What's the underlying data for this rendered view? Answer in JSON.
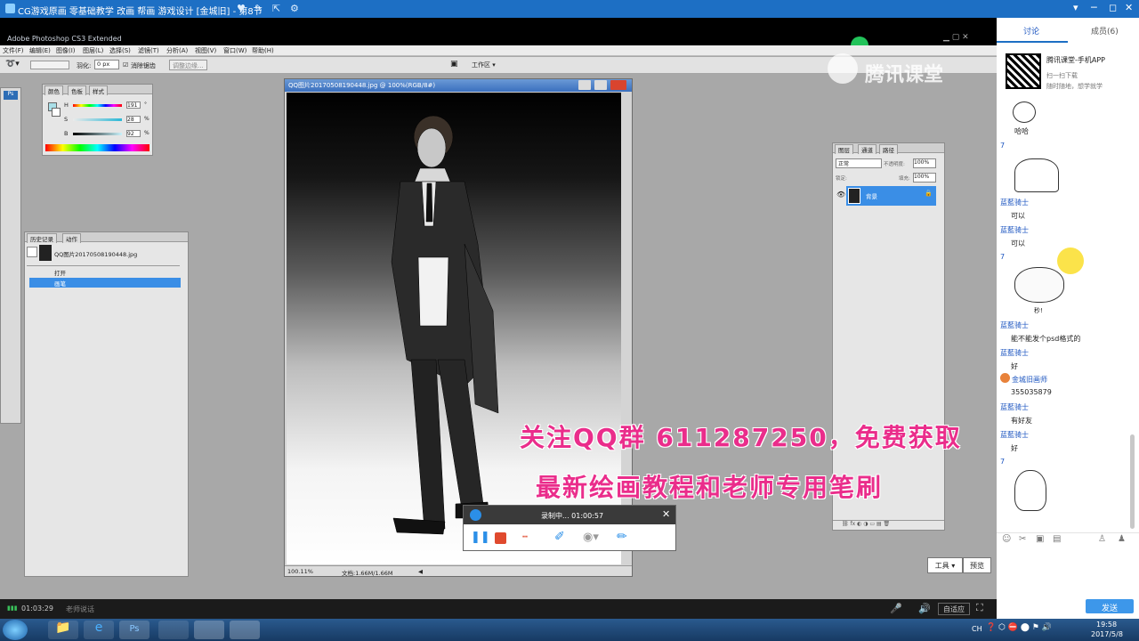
{
  "window": {
    "title": "CG游戏原画 零基础教学 改画 帮画 游戏设计 [金城旧] - 第8节",
    "controls": [
      "▾",
      "─",
      "◻",
      "✕"
    ]
  },
  "photoshop": {
    "app_title": "Adobe Photoshop CS3 Extended",
    "menus": [
      "文件(F)",
      "编辑(E)",
      "图像(I)",
      "图层(L)",
      "选择(S)",
      "滤镜(T)",
      "分析(A)",
      "视图(V)",
      "窗口(W)",
      "帮助(H)"
    ],
    "options": {
      "feather_label": "羽化:",
      "feather_value": "0 px",
      "antialias_label": "消除锯齿",
      "refine_label": "调整边缘...",
      "workspace_label": "工作区 ▾"
    },
    "color_panel": {
      "tabs": [
        "颜色",
        "色板",
        "样式"
      ],
      "sliders": [
        {
          "label": "H",
          "value": "191",
          "unit": "°"
        },
        {
          "label": "S",
          "value": "28",
          "unit": "%"
        },
        {
          "label": "B",
          "value": "92",
          "unit": "%"
        }
      ]
    },
    "history_panel": {
      "tabs": [
        "历史记录",
        "动作"
      ],
      "snapshot": "QQ图片20170508190448.jpg",
      "items": [
        "打开",
        "画笔"
      ]
    },
    "layers_panel": {
      "tabs": [
        "图层",
        "通道",
        "路径"
      ],
      "blend_mode": "正常",
      "opacity_label": "不透明度:",
      "opacity_value": "100%",
      "lock_label": "锁定:",
      "fill_label": "填充:",
      "fill_value": "100%",
      "layer_name": "背景"
    },
    "document": {
      "title": "QQ图片20170508190448.jpg @ 100%(RGB/8#)",
      "zoom": "100.11%",
      "doc_size": "文档:1.66M/1.66M"
    }
  },
  "overlay": {
    "promo_line1": "关注QQ群 611287250，免费获取",
    "promo_line2": "最新绘画教程和老师专用笔刷",
    "watermark": "腾讯课堂"
  },
  "recorder": {
    "status": "录制中... 01:00:57"
  },
  "player": {
    "elapsed": "01:03:29",
    "teacher_label": "老师说话",
    "fit_label": "自适应"
  },
  "canvas_buttons": {
    "tools_label": "工具 ▾",
    "preview_label": "预览"
  },
  "sidebar": {
    "tabs": [
      "讨论",
      "成员(6)"
    ],
    "app_promo": {
      "title": "腾讯课堂-手机APP",
      "line1": "扫一扫下载",
      "line2": "随时随地，想学就学"
    },
    "messages": [
      {
        "name": "",
        "text": "哈哈"
      },
      {
        "name": "7",
        "text": ""
      },
      {
        "name": "蓝藍骑士",
        "text": "可以"
      },
      {
        "name": "蓝藍骑士",
        "text": "可以"
      },
      {
        "name": "7",
        "text": ""
      },
      {
        "name": "",
        "text": "秒!"
      },
      {
        "name": "蓝藍骑士",
        "text": "能不能发个psd格式的"
      },
      {
        "name": "蓝藍骑士",
        "text": "好"
      },
      {
        "name": "金城旧画师",
        "text": "355035879"
      },
      {
        "name": "蓝藍骑士",
        "text": "有好友"
      },
      {
        "name": "蓝藍骑士",
        "text": "好"
      },
      {
        "name": "7",
        "text": ""
      }
    ],
    "send_label": "发送"
  },
  "taskbar": {
    "time": "19:58",
    "date": "2017/5/8",
    "tray_text": "CH"
  }
}
